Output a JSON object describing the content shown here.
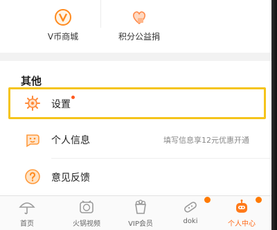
{
  "shortcuts": [
    {
      "label": "V币商城",
      "icon": "v-coin-icon"
    },
    {
      "label": "积分公益捐",
      "icon": "charity-gift-icon"
    }
  ],
  "section": {
    "title": "其他"
  },
  "rows": [
    {
      "label": "设置",
      "icon": "settings-gear-icon",
      "hint": ""
    },
    {
      "label": "个人信息",
      "icon": "personal-info-icon",
      "hint": "填写信息享12元优惠开通"
    },
    {
      "label": "意见反馈",
      "icon": "feedback-question-icon",
      "hint": ""
    }
  ],
  "tabbar": {
    "items": [
      {
        "label": "首页",
        "icon": "umbrella-icon"
      },
      {
        "label": "火锅视频",
        "icon": "hotpot-video-icon"
      },
      {
        "label": "VIP会员",
        "icon": "vip-popcorn-icon"
      },
      {
        "label": "doki",
        "icon": "doki-icon"
      },
      {
        "label": "个人中心",
        "icon": "profile-robot-icon"
      }
    ],
    "active_index": 4
  },
  "colors": {
    "accent": "#ff6a1a",
    "highlight": "#f5c41b",
    "badge": "#ff7a00"
  }
}
